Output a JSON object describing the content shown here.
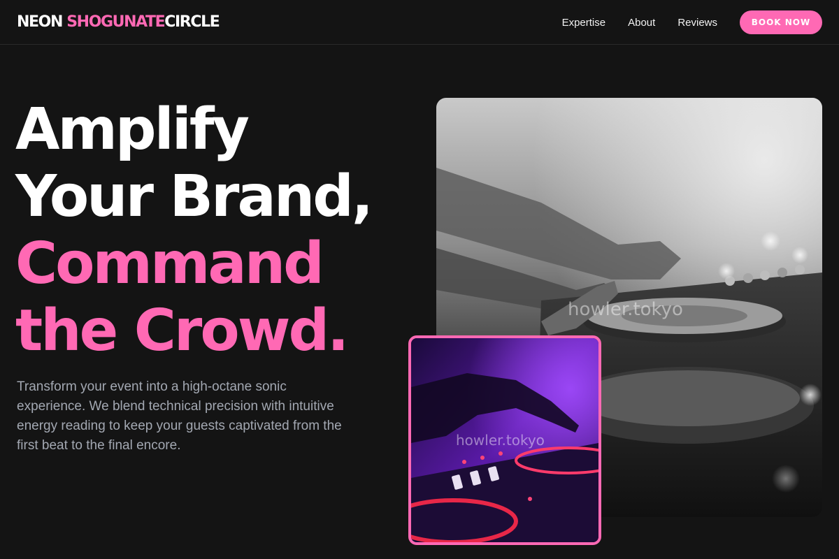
{
  "brand": {
    "part1": "NEON",
    "part2": "SHOGUNATE",
    "part3": "CIRCLE"
  },
  "nav": {
    "links": [
      "Expertise",
      "About",
      "Reviews"
    ],
    "cta": "BOOK NOW"
  },
  "hero": {
    "headline_line1": "Amplify",
    "headline_line2": "Your Brand,",
    "headline_line3": "Command",
    "headline_line4": "the Crowd.",
    "subtext": "Transform your event into a high-octane sonic experience. We blend technical precision with intuitive energy reading to keep your guests captivated from the first beat to the final encore."
  },
  "images": {
    "main_watermark": "howler.tokyo",
    "inset_watermark": "howler.tokyo"
  },
  "colors": {
    "accent": "#ff69b4",
    "background": "#141414",
    "body_text": "#a3a8b2"
  }
}
